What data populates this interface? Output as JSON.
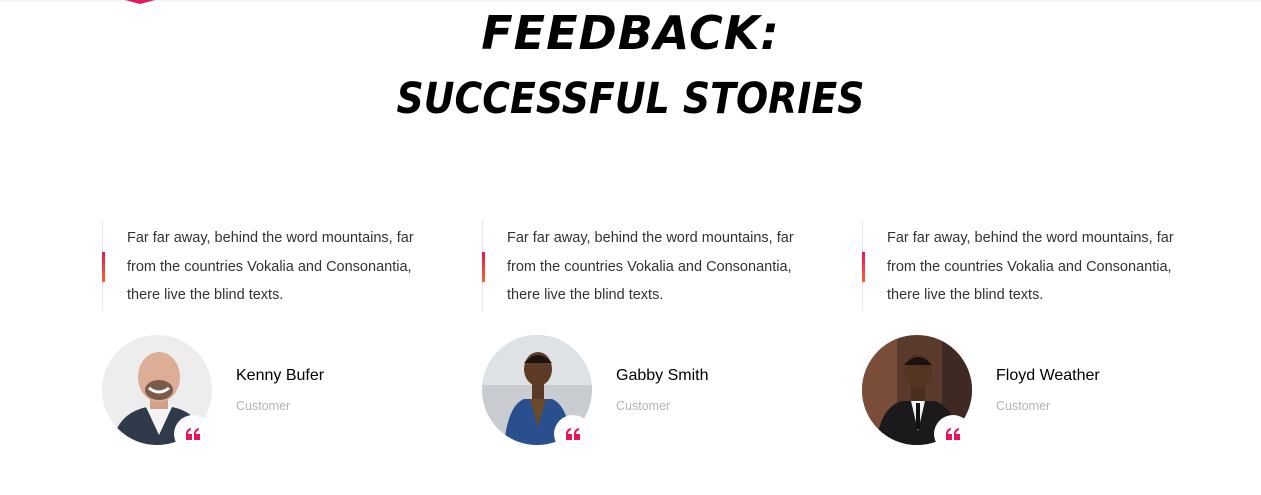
{
  "colors": {
    "accent_start": "#e8155e",
    "accent_end": "#f2672e",
    "heading": "#000000",
    "muted": "#b3b3b3"
  },
  "section": {
    "title_line1": "FEEDBACK:",
    "title_line2": "SUCCESSFUL STORIES"
  },
  "testimonials": [
    {
      "text": "Far far away, behind the word mountains, far from the countries Vokalia and Consonantia, there live the blind texts.",
      "name": "Kenny Bufer",
      "role": "Customer",
      "avatar_icon": "person-photo-icon",
      "badge_icon": "quote-icon"
    },
    {
      "text": "Far far away, behind the word mountains, far from the countries Vokalia and Consonantia, there live the blind texts.",
      "name": "Gabby Smith",
      "role": "Customer",
      "avatar_icon": "person-photo-icon",
      "badge_icon": "quote-icon"
    },
    {
      "text": "Far far away, behind the word mountains, far from the countries Vokalia and Consonantia, there live the blind texts.",
      "name": "Floyd Weather",
      "role": "Customer",
      "avatar_icon": "person-photo-icon",
      "badge_icon": "quote-icon"
    }
  ]
}
